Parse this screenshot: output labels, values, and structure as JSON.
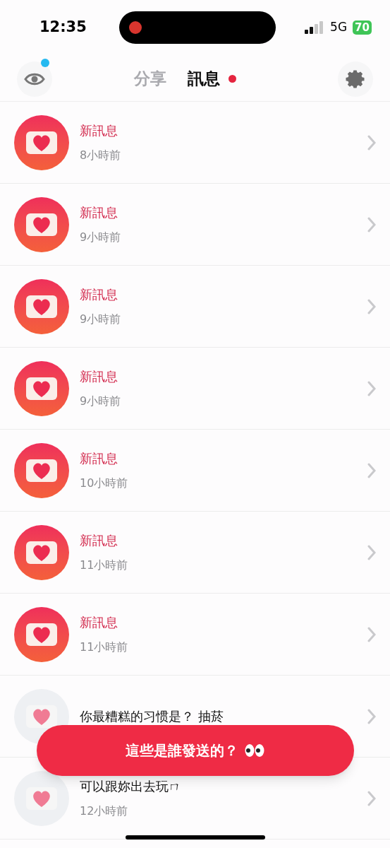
{
  "status_bar": {
    "time": "12:35",
    "recording": true,
    "network": "5G",
    "battery": "70"
  },
  "header": {
    "viewer_badge": true,
    "tabs": [
      {
        "label": "分享",
        "selected": false,
        "badge": false
      },
      {
        "label": "訊息",
        "selected": true,
        "badge": true
      }
    ]
  },
  "messages": [
    {
      "title": "新訊息",
      "time": "8小時前",
      "read": false
    },
    {
      "title": "新訊息",
      "time": "9小時前",
      "read": false
    },
    {
      "title": "新訊息",
      "time": "9小時前",
      "read": false
    },
    {
      "title": "新訊息",
      "time": "9小時前",
      "read": false
    },
    {
      "title": "新訊息",
      "time": "10小時前",
      "read": false
    },
    {
      "title": "新訊息",
      "time": "11小時前",
      "read": false
    },
    {
      "title": "新訊息",
      "time": "11小時前",
      "read": false
    },
    {
      "title": "你最糟糕的习惯是？ 抽菸",
      "read": true
    },
    {
      "title": "可以跟妳出去玩ㄇ",
      "time": "12小時前",
      "read": true
    }
  ],
  "action_button": {
    "label": "這些是誰發送的？"
  }
}
